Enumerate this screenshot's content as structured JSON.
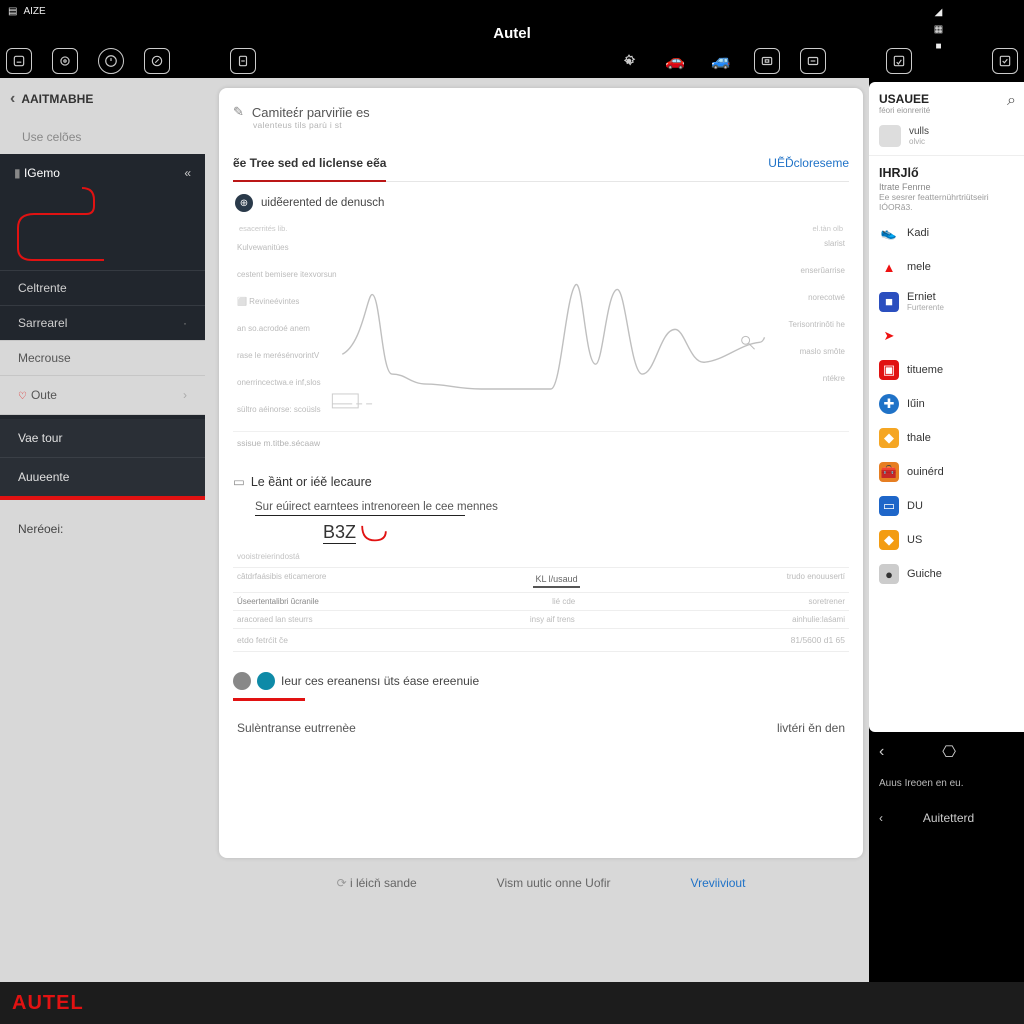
{
  "status": {
    "left_badge": "AIZE",
    "right_icons": [
      "wifi",
      "signal",
      "signal",
      "grid"
    ]
  },
  "titlebar": "Autel",
  "toolbar": {
    "left_count": 5,
    "right_count": 6
  },
  "sidebar": {
    "breadcrumb": "AAITMABHE",
    "use": "Use celões",
    "active": "IGemo",
    "items": [
      "Celtrente",
      "Sarrearel",
      "Mecrouse"
    ],
    "oute": "Oute",
    "vaet": "Vae tour",
    "auert": "Auueente",
    "network": "Neréoei:"
  },
  "card": {
    "header": "Camiteέr parvirǐie es",
    "header_sub": "valenteus tils   parù i st",
    "tab_active": "ẽe Tree sed ed liclense eẽa",
    "tab_link": "UẼĎcloreseme",
    "detail_title": "uidẽerented de denusch",
    "detail_sub_l": "esacerrités lib.",
    "detail_sub_r": "el.tàn olb",
    "chart_left": [
      "Kulvewanitúes",
      "cestent bemisere itexvorsun",
      "⬜  Revineévintes",
      "an so.acrodoé anem",
      "rase le merésénvorintV",
      "onerrincectwa.e    inf,slos",
      "sültro aéinorse: scoüsls"
    ],
    "chart_right": [
      "slarist",
      "enserŭarrise",
      "norecotwé",
      "Terisontrinôti he",
      "maslo smôte",
      "ntékre"
    ],
    "chart_textrows": [
      {
        "l": "ssisue m.titbe.sécaaw",
        "r": ""
      }
    ],
    "s2_head": "Le ềänt or iéě lecaure",
    "s2_sub": "Sur eúirect earntees intrenoreen  le cee mennes",
    "b3z": "B3Z",
    "s2_muted": "vooistreierindostá",
    "s2_row1_l": "câtdrfaásibis eticamerore",
    "s2_row1_m_tab": "KL   l/usaud",
    "s2_row1_r": "trudo enouusertí",
    "s2_row2_l": "Úseertentalibri ŭcranile",
    "s2_row2_m": "lié cde",
    "s2_row2_r": "soretrener",
    "s2_row3_l": "aracoraed lan steurrs",
    "s2_row3_m": "insy aif trens",
    "s2_row3_r": "ainhulie:laśami",
    "s2_row4_l": "etdo fetrćit če",
    "s2_row4_r": "81/5600 d1 65",
    "s3_head": "Ieur ces ereanensı üts éase ereenuie",
    "s3_foot_l": "Sulèntranse eutrrenèe",
    "s3_foot_r": "livtéri ěn den",
    "actions": {
      "a": "i léicň sande",
      "b": "Vism uutic onne Uofir",
      "c": "Vreviiviout"
    }
  },
  "right": {
    "title": "USAUEE",
    "subtitle": "féori eionrerité",
    "user_name": "vulls",
    "user_sub": "olvic",
    "section": "IHRJlő",
    "section_sub1": "Itrate Fenrne",
    "section_sub2": "Ee sesrer featternührtriütseiri",
    "section_sub3": "IÓORǎ3.",
    "apps": [
      {
        "label": "Kadi",
        "icon": "👟",
        "cls": "col-red"
      },
      {
        "label": "mele",
        "icon": "▲",
        "cls": "col-red"
      },
      {
        "label": "Erniet",
        "icon": "■",
        "cls": "bg-blue",
        "sub": "Furterente"
      },
      {
        "label": "",
        "icon": "➤",
        "cls": "col-red"
      },
      {
        "label": "titueme",
        "icon": "▣",
        "cls": "bg-redbox"
      },
      {
        "label": "Iűin",
        "icon": "✚",
        "cls": "bg-lblue",
        "round": true
      },
      {
        "label": "thale",
        "icon": "◆",
        "cls": "bg-orange"
      },
      {
        "label": "ouinérd",
        "icon": "🧰",
        "cls": "bg-case"
      },
      {
        "label": "DU",
        "icon": "▭",
        "cls": "bg-card"
      },
      {
        "label": "US",
        "icon": "◆",
        "cls": "bg-or2"
      },
      {
        "label": "Guiche",
        "icon": "●",
        "cls": "bg-grey"
      }
    ],
    "nav_text": "Auus  Ireoen en eu.",
    "nav_text2": "Auitetterd"
  },
  "footer_brand": "AUTEL"
}
